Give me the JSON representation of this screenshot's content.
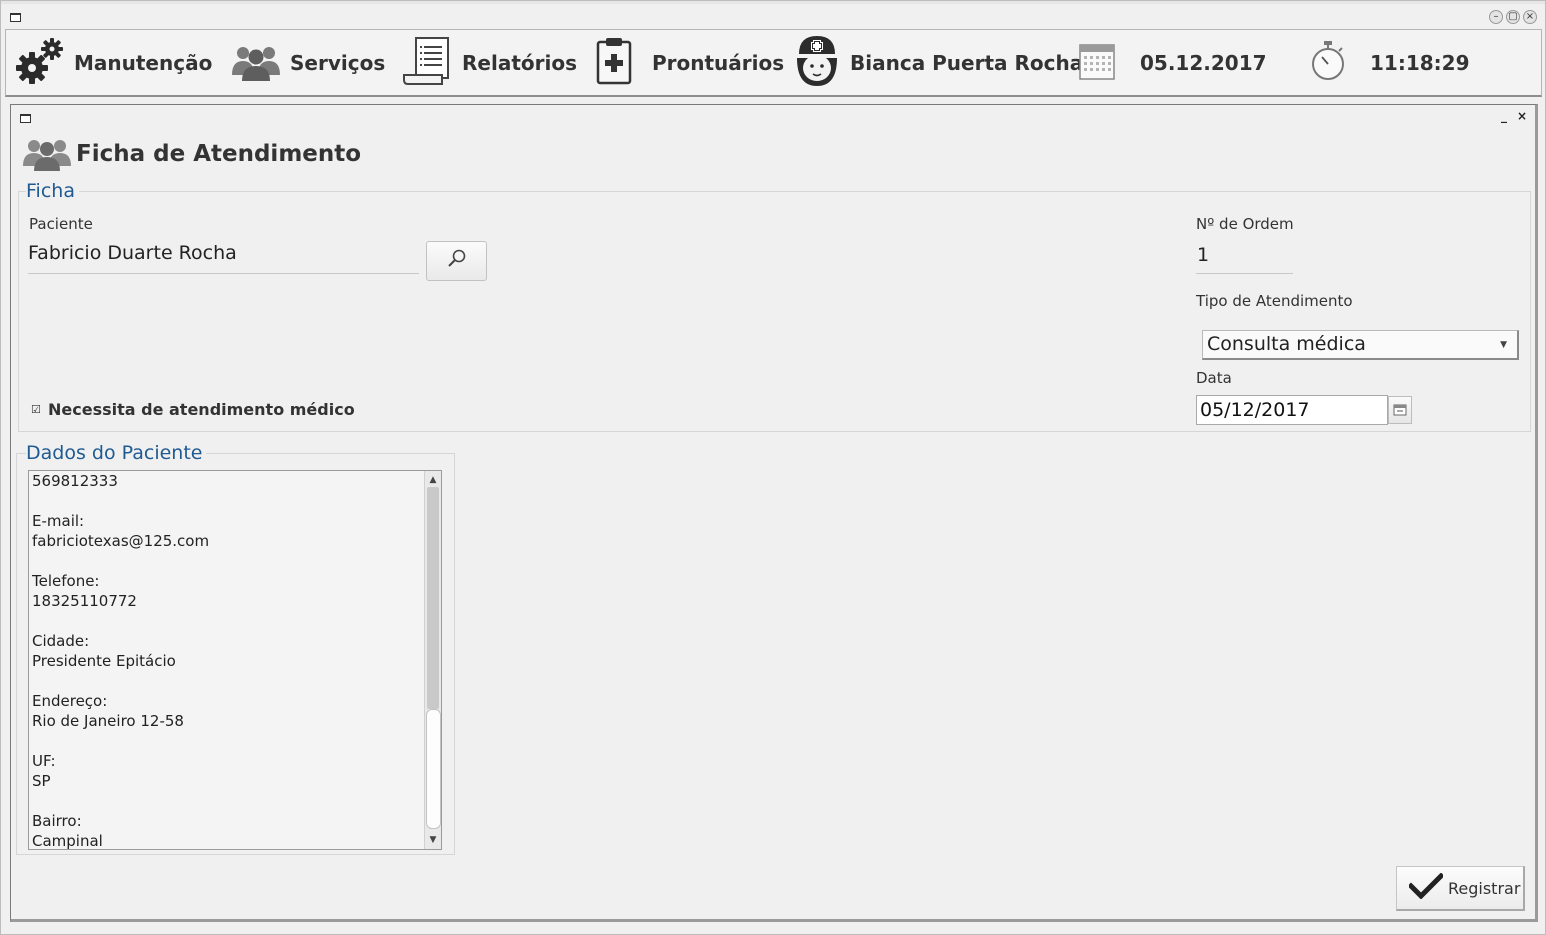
{
  "toolbar": {
    "items": [
      {
        "label": "Manutenção",
        "icon": "gears-icon"
      },
      {
        "label": "Serviços",
        "icon": "users-icon"
      },
      {
        "label": "Relatórios",
        "icon": "report-icon"
      },
      {
        "label": "Prontuários",
        "icon": "clipboard-icon"
      },
      {
        "label": "Bianca Puerta Rocha",
        "icon": "nurse-icon"
      }
    ],
    "date": "05.12.2017",
    "time": "11:18:29"
  },
  "form": {
    "title": "Ficha de Atendimento",
    "ficha_group": "Ficha",
    "patient_label": "Paciente",
    "patient_value": "Fabricio Duarte Rocha",
    "order_label": "Nº de Ordem",
    "order_value": "1",
    "type_label": "Tipo de Atendimento",
    "type_value": "Consulta médica",
    "date_label": "Data",
    "date_value": "05/12/2017",
    "needs_medical_label": "Necessita de atendimento médico",
    "needs_medical_checked": true,
    "patient_data_group": "Dados do Paciente",
    "patient_data_lines": [
      "569812333",
      "",
      "E-mail:",
      "fabriciotexas@125.com",
      "",
      "Telefone:",
      "18325110772",
      "",
      "Cidade:",
      "Presidente Epitácio",
      "",
      "Endereço:",
      "Rio de Janeiro 12-58",
      "",
      "UF:",
      "SP",
      "",
      "Bairro:",
      "Campinal"
    ],
    "register_label": "Registrar"
  }
}
